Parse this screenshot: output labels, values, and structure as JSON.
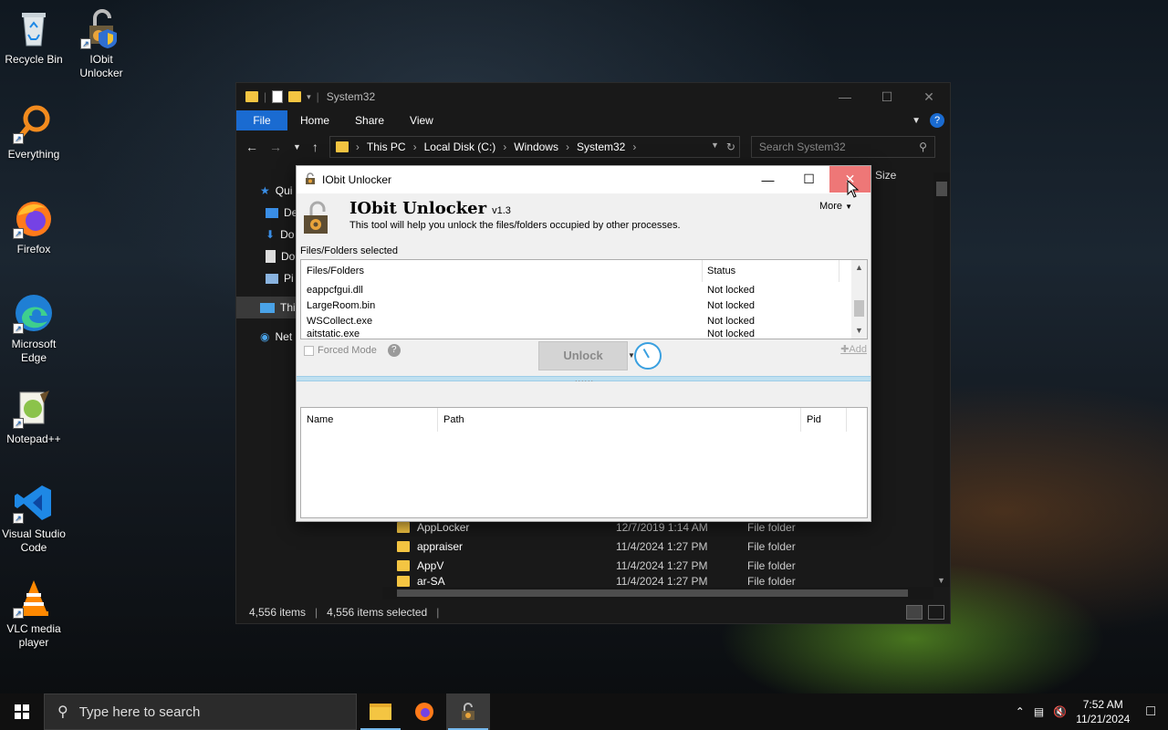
{
  "desktop": {
    "icons": [
      {
        "label": "Recycle Bin"
      },
      {
        "label": "IObit Unlocker"
      },
      {
        "label": "Everything"
      },
      {
        "label": "Firefox"
      },
      {
        "label": "Microsoft Edge"
      },
      {
        "label": "Notepad++"
      },
      {
        "label": "Visual Studio Code"
      },
      {
        "label": "VLC media player"
      }
    ]
  },
  "explorer": {
    "title": "System32",
    "ribbon": {
      "file": "File",
      "home": "Home",
      "share": "Share",
      "view": "View"
    },
    "breadcrumb": [
      "This PC",
      "Local Disk (C:)",
      "Windows",
      "System32"
    ],
    "search_placeholder": "Search System32",
    "sidebar": [
      {
        "label": "Qui"
      },
      {
        "label": "De"
      },
      {
        "label": "Do"
      },
      {
        "label": "Do"
      },
      {
        "label": "Pi"
      },
      {
        "label": "This"
      },
      {
        "label": "Net"
      }
    ],
    "column_size": "Size",
    "files": [
      {
        "name": "AppLocker",
        "date": "12/7/2019 1:14 AM",
        "type": "File folder"
      },
      {
        "name": "appraiser",
        "date": "11/4/2024 1:27 PM",
        "type": "File folder"
      },
      {
        "name": "AppV",
        "date": "11/4/2024 1:27 PM",
        "type": "File folder"
      },
      {
        "name": "ar-SA",
        "date": "11/4/2024 1:27 PM",
        "type": "File folder"
      }
    ],
    "status": {
      "items": "4,556 items",
      "selected": "4,556 items selected"
    }
  },
  "iobit": {
    "window_title": "IObit Unlocker",
    "app_name": "IObit Unlocker",
    "version": "v1.3",
    "description": "This tool will help you unlock the files/folders occupied by other processes.",
    "more": "More",
    "files_label": "Files/Folders selected",
    "columns": {
      "files": "Files/Folders",
      "status": "Status"
    },
    "rows": [
      {
        "name": "eappcfgui.dll",
        "status": "Not locked"
      },
      {
        "name": "LargeRoom.bin",
        "status": "Not locked"
      },
      {
        "name": "WSCollect.exe",
        "status": "Not locked"
      },
      {
        "name": "aitstatic.exe",
        "status": "Not locked"
      }
    ],
    "forced_mode": "Forced Mode",
    "unlock": "Unlock",
    "add": "Add",
    "proc_columns": {
      "name": "Name",
      "path": "Path",
      "pid": "Pid"
    }
  },
  "taskbar": {
    "search_placeholder": "Type here to search",
    "time": "7:52 AM",
    "date": "11/21/2024"
  }
}
